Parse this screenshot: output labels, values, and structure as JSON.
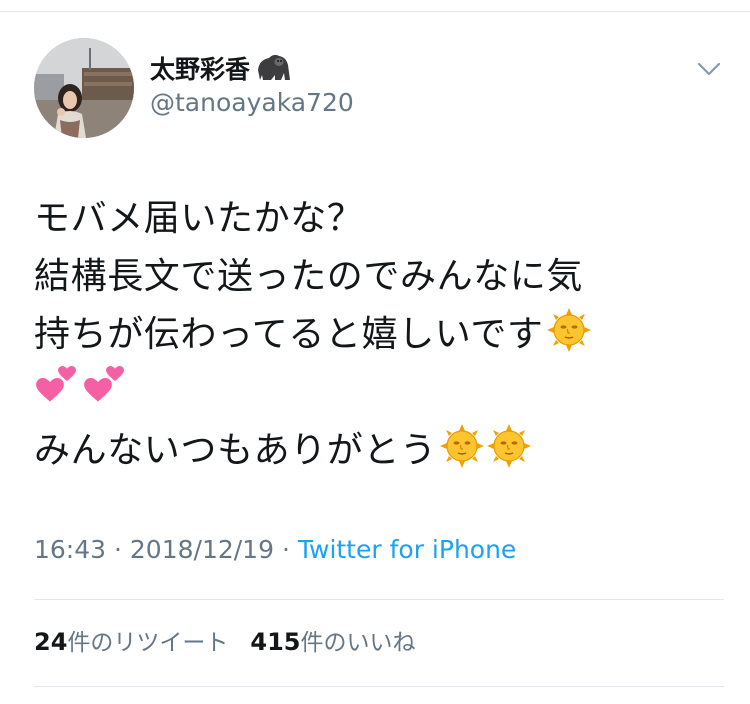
{
  "tweet": {
    "author_name": "太野彩香",
    "author_emoji": "gorilla-emoji",
    "handle": "@tanoayaka720",
    "lines": [
      "モバメ届いたかな？",
      "結構長文で送ったのでみんなに気",
      "持ちが伝わってると嬉しいです",
      "",
      "みんないつもありがとう"
    ],
    "emojis": [
      "sun-with-face-emoji",
      "two-hearts-emoji"
    ],
    "time": "16:43",
    "date": "2018/12/19",
    "separator": "·",
    "source": "Twitter for iPhone"
  },
  "stats": {
    "retweets_count": "24",
    "retweets_label": "件のリツイート",
    "likes_count": "415",
    "likes_label": "件のいいね"
  },
  "colors": {
    "text": "#14171a",
    "secondary": "#657786",
    "link": "#1da1f2",
    "divider": "#e1e8ed"
  }
}
